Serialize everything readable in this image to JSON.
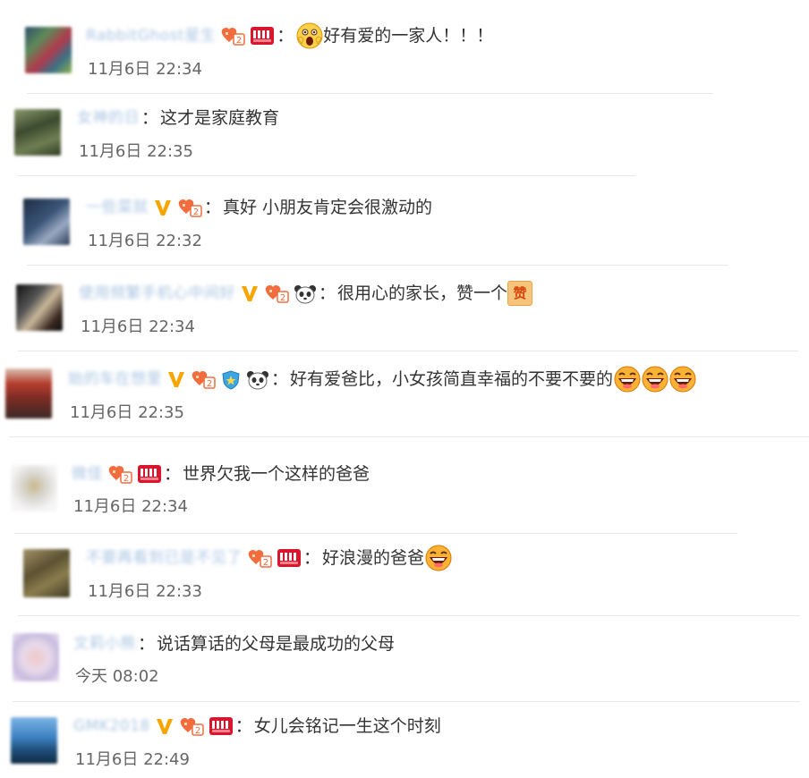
{
  "colors": {
    "name": "#a9c4e2",
    "text": "#333333",
    "time": "#666666",
    "divider": "#e8e8e8",
    "vip": "#f7a600",
    "fan_badge": "#f36c3d",
    "member_badge": "#d8172f"
  },
  "comments": [
    {
      "name": "RabbitGhost星生",
      "text": "好有爱的一家人！！！",
      "time": "11月6日 22:34",
      "badges": [
        "fan-badge-icon",
        "member-badge-icon"
      ],
      "emoji": "shocked-emoji-icon"
    },
    {
      "name": "女神的日",
      "text": "这才是家庭教育",
      "time": "11月6日 22:35",
      "badges": []
    },
    {
      "name": "一些菜就",
      "text": "真好  小朋友肯定会很激动的",
      "time": "11月6日 22:32",
      "badges": [
        "vip-v-icon",
        "fan-badge-icon"
      ]
    },
    {
      "name": "使用频繁手机心中间好",
      "text": "很用心的家长，赞一个",
      "time": "11月6日 22:34",
      "badges": [
        "vip-v-icon",
        "fan-badge-icon",
        "panda-icon"
      ],
      "trailing": "赞"
    },
    {
      "name": "始的车在想里",
      "text": "好有爱爸比，小女孩简直幸福的不要不要的",
      "time": "11月6日 22:35",
      "badges": [
        "vip-v-icon",
        "fan-badge-icon",
        "shield-badge-icon",
        "panda-icon"
      ],
      "emoji": "laughing-emoji-icon"
    },
    {
      "name": "微佳",
      "text": "世界欠我一个这样的爸爸",
      "time": "11月6日 22:34",
      "badges": [
        "fan-badge-icon",
        "member-badge-icon"
      ]
    },
    {
      "name": "不要再看到已是不见了",
      "text": "好浪漫的爸爸",
      "time": "11月6日 22:33",
      "badges": [
        "fan-badge-icon",
        "member-badge-icon"
      ],
      "emoji": "laughing-emoji-icon"
    },
    {
      "name": "文莉小熊",
      "text": "说话算话的父母是最成功的父母",
      "time": "今天 08:02",
      "badges": []
    },
    {
      "name": "GMK2018",
      "text": "女儿会铭记一生这个时刻",
      "time": "11月6日 22:49",
      "badges": [
        "vip-v-icon",
        "fan-badge-icon",
        "member-badge-icon"
      ]
    }
  ]
}
